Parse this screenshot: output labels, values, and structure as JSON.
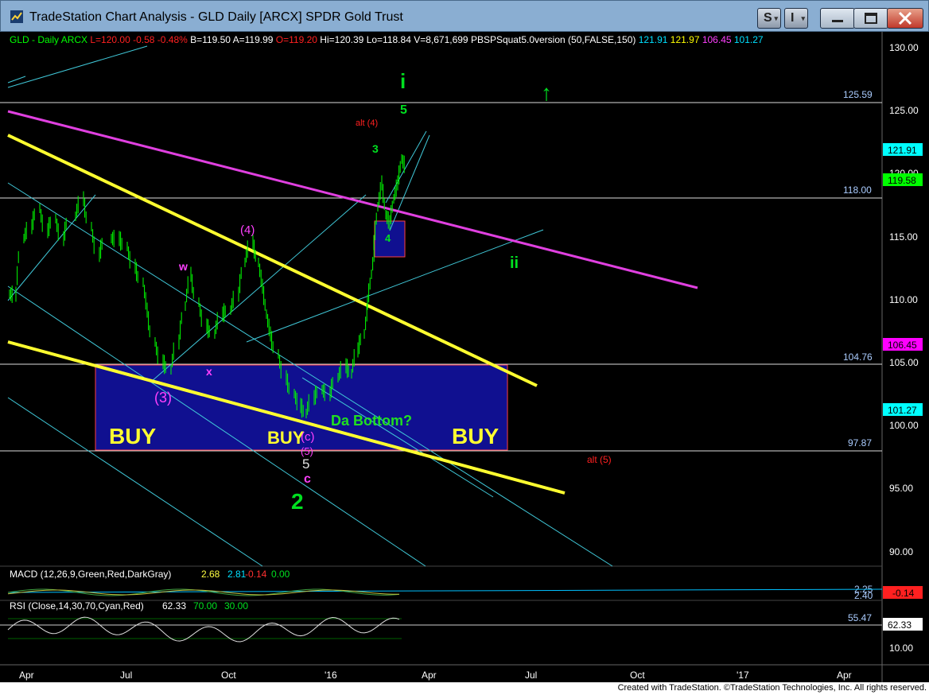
{
  "window": {
    "title": "TradeStation Chart Analysis - GLD Daily [ARCX] SPDR Gold Trust",
    "s_button": "S",
    "i_button": "I"
  },
  "header": [
    {
      "text": "GLD - Daily",
      "color": "#00ff00"
    },
    {
      "text": "ARCX",
      "color": "#00ff00"
    },
    {
      "text": "L=120.00",
      "color": "#ff2020"
    },
    {
      "text": "-0.58",
      "color": "#ff2020"
    },
    {
      "text": "-0.48%",
      "color": "#ff2020"
    },
    {
      "text": "B=119.50",
      "color": "#ffffff"
    },
    {
      "text": "A=119.99",
      "color": "#ffffff"
    },
    {
      "text": "O=119.20",
      "color": "#ff2020"
    },
    {
      "text": "Hi=120.39",
      "color": "#ffffff"
    },
    {
      "text": "Lo=118.84",
      "color": "#ffffff"
    },
    {
      "text": "V=8,671,699",
      "color": "#ffffff"
    },
    {
      "text": "PBSPSquat5.0version (50,FALSE,150)",
      "color": "#ffffff"
    },
    {
      "text": "121.91",
      "color": "#00e0ff"
    },
    {
      "text": "121.97",
      "color": "#ffff00"
    },
    {
      "text": "106.45",
      "color": "#ff40ff"
    },
    {
      "text": "101.27",
      "color": "#00e0ff"
    }
  ],
  "price_axis": {
    "ticks": [
      "130.00",
      "125.00",
      "120.00",
      "115.00",
      "110.00",
      "105.00",
      "100.00",
      "95.00",
      "90.00"
    ],
    "markers": [
      {
        "text": "121.91",
        "bg": "#00ffff",
        "fg": "#000000"
      },
      {
        "text": "119.58",
        "bg": "#00ff00",
        "fg": "#000000"
      },
      {
        "text": "106.45",
        "bg": "#ff00ff",
        "fg": "#000000"
      },
      {
        "text": "101.27",
        "bg": "#00ffff",
        "fg": "#000000"
      }
    ]
  },
  "levels": [
    "125.59",
    "118.00",
    "104.76",
    "97.87"
  ],
  "time_axis": [
    "Apr",
    "Jul",
    "Oct",
    "'16",
    "Apr",
    "Jul",
    "Oct",
    "'17",
    "Apr"
  ],
  "annotations": {
    "wave_i": "i",
    "wave_5_top": "5",
    "alt4": "alt (4)",
    "wave_3": "3",
    "wave_4": "4",
    "wave_ii": "ii",
    "paren4": "(4)",
    "w": "w",
    "x": "x",
    "paren3": "(3)",
    "buy_left": "BUY",
    "buy_mid": "BUY",
    "buy_right": "BUY",
    "da_bottom": "Da Bottom?",
    "c_paren": "(c)",
    "paren5": "(5)",
    "five_white": "5",
    "c_small": "c",
    "wave_2": "2",
    "alt5": "alt (5)",
    "arrow_up": "↑"
  },
  "macd": {
    "label": "MACD (12,26,9,Green,Red,DarkGray)",
    "v1": "2.68",
    "v2": "2.81",
    "v3": "-0.14",
    "v4": "0.00",
    "axis": [
      "2.25",
      "2.40"
    ],
    "marker": "-0.14"
  },
  "rsi": {
    "label": "RSI (Close,14,30,70,Cyan,Red)",
    "v1": "62.33",
    "v2": "70.00",
    "v3": "30.00",
    "level": "55.47",
    "axis_bottom": "10.00",
    "marker": "62.33"
  },
  "footer": "Created with TradeStation. ©TradeStation Technologies, Inc. All rights reserved."
}
